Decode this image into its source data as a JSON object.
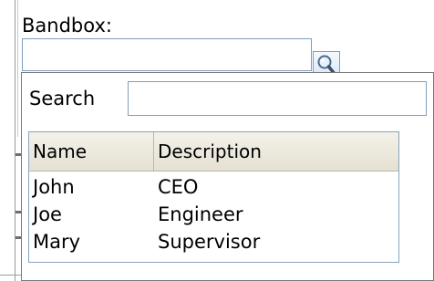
{
  "bandbox": {
    "label": "Bandbox:",
    "value": ""
  },
  "popup": {
    "search_label": "Search",
    "search_value": "",
    "columns": [
      "Name",
      "Description"
    ],
    "rows": [
      {
        "name": "John",
        "description": "CEO"
      },
      {
        "name": "Joe",
        "description": "Engineer"
      },
      {
        "name": "Mary",
        "description": "Supervisor"
      }
    ]
  },
  "icons": {
    "bandbox_button": "magnifier-icon"
  },
  "colors": {
    "input_border": "#7f9db9",
    "header_bg": "#e4e0d2",
    "grid_border": "#86a4be"
  }
}
